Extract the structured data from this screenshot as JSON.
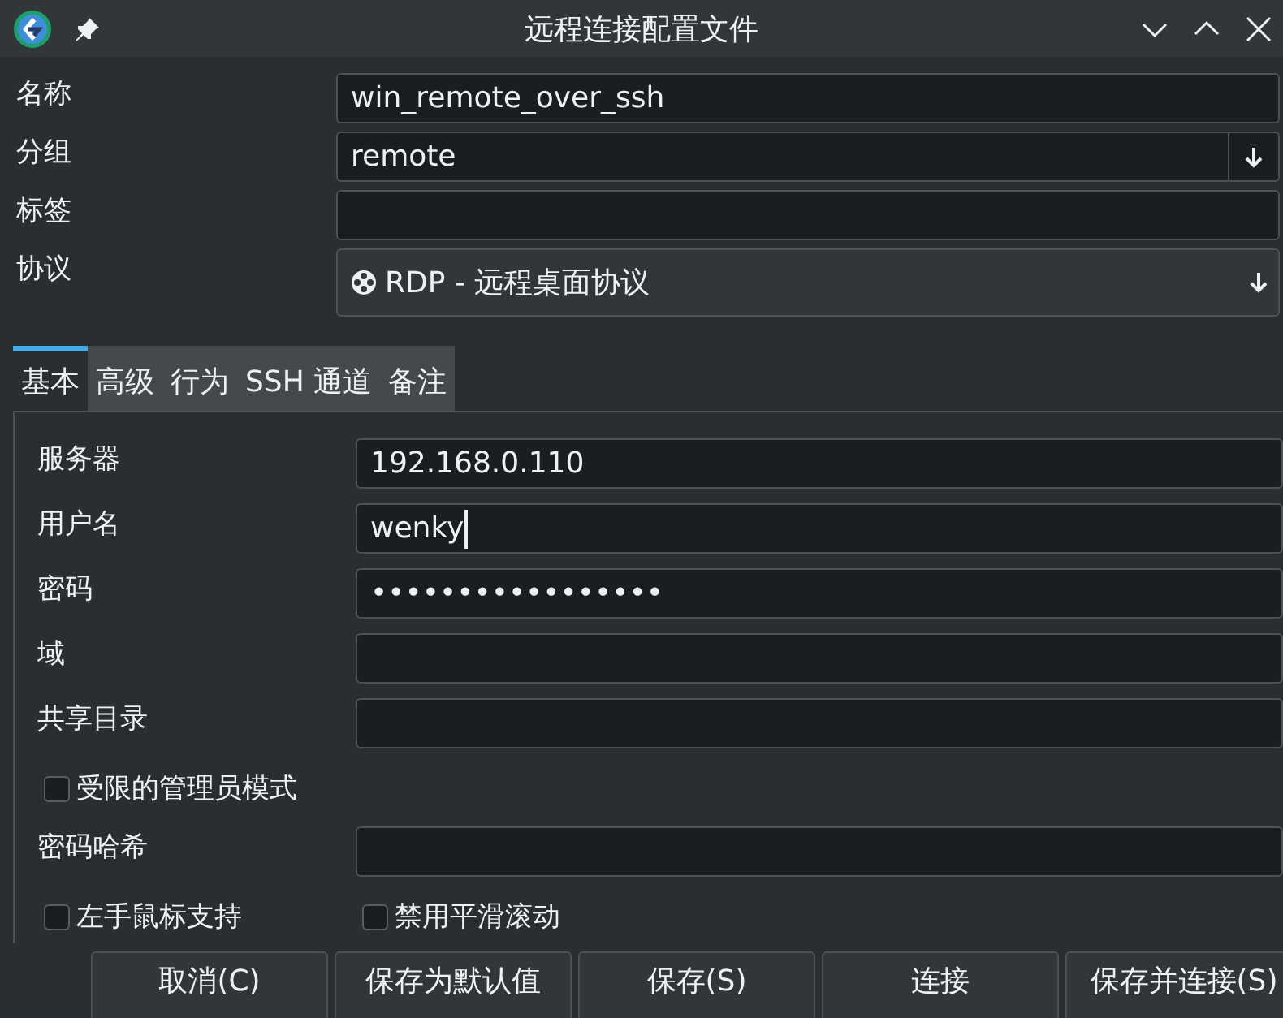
{
  "window": {
    "title": "远程连接配置文件"
  },
  "fields": [
    {
      "label": "名称",
      "kind": "text",
      "value": "win_remote_over_ssh"
    },
    {
      "label": "分组",
      "kind": "combo",
      "value": "remote"
    },
    {
      "label": "标签",
      "kind": "text"
    },
    {
      "label": "协议",
      "kind": "protocol",
      "value": "RDP - 远程桌面协议"
    }
  ],
  "tabs": [
    {
      "label": "基本",
      "selected": true
    },
    {
      "label": "高级",
      "selected": false
    },
    {
      "label": "行为",
      "selected": false
    },
    {
      "label": "SSH 通道",
      "selected": false
    },
    {
      "label": "备注",
      "selected": false
    }
  ],
  "basic": [
    {
      "kind": "field",
      "label": "服务器",
      "value": "192.168.0.110",
      "focused": false
    },
    {
      "kind": "field",
      "label": "用户名",
      "value": "wenky",
      "focused": true
    },
    {
      "kind": "field",
      "label": "密码",
      "value": "•••••••••••••••••",
      "focused": false
    },
    {
      "kind": "field",
      "label": "域",
      "focused": false
    },
    {
      "kind": "field",
      "label": "共享目录",
      "focused": false
    },
    {
      "kind": "checks",
      "items": [
        {
          "label": "受限的管理员模式",
          "checked": false
        }
      ]
    },
    {
      "kind": "field",
      "label": "密码哈希",
      "focused": false
    },
    {
      "kind": "checks",
      "items": [
        {
          "label": "左手鼠标支持",
          "checked": false
        },
        {
          "label": "禁用平滑滚动",
          "checked": false
        }
      ]
    }
  ],
  "buttons": [
    "取消(C)",
    "保存为默认值",
    "保存(S)",
    "连接",
    "保存并连接(S)"
  ]
}
